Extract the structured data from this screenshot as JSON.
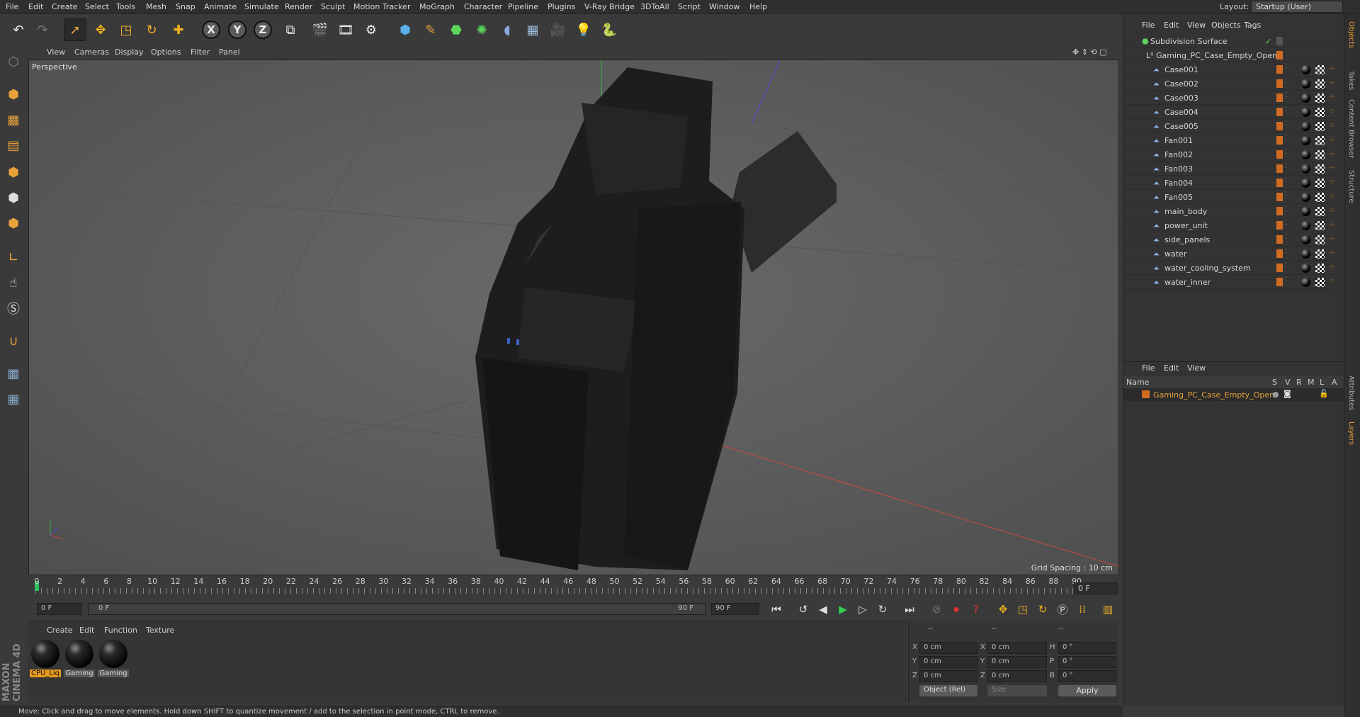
{
  "menu": [
    "File",
    "Edit",
    "Create",
    "Select",
    "Tools",
    "Mesh",
    "Snap",
    "Animate",
    "Simulate",
    "Render",
    "Sculpt",
    "Motion Tracker",
    "MoGraph",
    "Character",
    "Pipeline",
    "Plugins",
    "V-Ray Bridge",
    "3DToAll",
    "Script",
    "Window",
    "Help"
  ],
  "layout": {
    "label": "Layout:",
    "value": "Startup (User)"
  },
  "toolbar": {
    "undo_icon": "undo-icon",
    "x": "X",
    "y": "Y",
    "z": "Z"
  },
  "viewport_menu": [
    "View",
    "Cameras",
    "Display",
    "Options",
    "Filter",
    "Panel"
  ],
  "viewport": {
    "label": "Perspective",
    "grid_spacing": "Grid Spacing : 10 cm"
  },
  "timeline": {
    "ticks": [
      "0",
      "2",
      "4",
      "6",
      "8",
      "10",
      "12",
      "14",
      "16",
      "18",
      "20",
      "22",
      "24",
      "26",
      "28",
      "30",
      "32",
      "34",
      "36",
      "38",
      "40",
      "42",
      "44",
      "46",
      "48",
      "50",
      "52",
      "54",
      "56",
      "58",
      "60",
      "62",
      "64",
      "66",
      "68",
      "70",
      "72",
      "74",
      "76",
      "78",
      "80",
      "82",
      "84",
      "86",
      "88",
      "90"
    ],
    "current_frame": "0 F",
    "start_field": "0 F",
    "range_start": "0 F",
    "range_end": "90 F",
    "end_field": "90 F"
  },
  "material_menu": [
    "Create",
    "Edit",
    "Function",
    "Texture"
  ],
  "materials": [
    {
      "label": "CPU_Liq",
      "selected": true
    },
    {
      "label": "Gaming",
      "selected": false
    },
    {
      "label": "Gaming",
      "selected": false
    }
  ],
  "coords": {
    "header": [
      "--",
      "--",
      "--"
    ],
    "rows": [
      {
        "a": "X",
        "av": "0 cm",
        "b": "X",
        "bv": "0 cm",
        "c": "H",
        "cv": "0 °"
      },
      {
        "a": "Y",
        "av": "0 cm",
        "b": "Y",
        "bv": "0 cm",
        "c": "P",
        "cv": "0 °"
      },
      {
        "a": "Z",
        "av": "0 cm",
        "b": "Z",
        "bv": "0 cm",
        "c": "B",
        "cv": "0 °"
      }
    ],
    "mode": "Object (Rel)",
    "size_mode": "Size",
    "apply": "Apply"
  },
  "status": "Move: Click and drag to move elements. Hold down SHIFT to quantize movement / add to the selection in point mode, CTRL to remove.",
  "brand": "MAXON CINEMA 4D",
  "objects_menu": [
    "File",
    "Edit",
    "View",
    "Objects",
    "Tags"
  ],
  "objects": {
    "root": "Subdivision Surface",
    "group": "Gaming_PC_Case_Empty_Open",
    "items": [
      "Case001",
      "Case002",
      "Case003",
      "Case004",
      "Case005",
      "Fan001",
      "Fan002",
      "Fan003",
      "Fan004",
      "Fan005",
      "main_body",
      "power_unit",
      "side_panels",
      "water",
      "water_cooling_system",
      "water_inner"
    ]
  },
  "layers_menu": [
    "File",
    "Edit",
    "View"
  ],
  "layers_head": {
    "name": "Name",
    "cols": [
      "S",
      "V",
      "R",
      "M",
      "L",
      "A"
    ]
  },
  "layer_row": "Gaming_PC_Case_Empty_Open",
  "side_tabs": [
    "Objects",
    "Takes",
    "Content Browser",
    "Structure",
    "Attributes",
    "Layers"
  ],
  "colors": {
    "accent": "#e89a1d",
    "layer_text": "#e8a23a",
    "chip": "#d16b22"
  }
}
